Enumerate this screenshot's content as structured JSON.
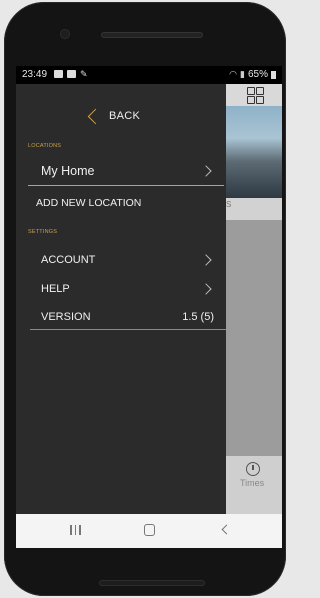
{
  "status_bar": {
    "time": "23:49",
    "battery_percent": "65%"
  },
  "drawer": {
    "back_label": "BACK",
    "locations_header": "LOCATIONS",
    "locations": [
      {
        "label": "My Home"
      }
    ],
    "add_location_label": "ADD NEW LOCATION",
    "settings_header": "SETTINGS",
    "settings_items": [
      {
        "label": "ACCOUNT"
      },
      {
        "label": "HELP"
      }
    ],
    "version_label": "VERSION",
    "version_value": "1.5 (5)"
  },
  "background_app": {
    "card_text": "S",
    "tab_label": "Times"
  },
  "icons": {
    "back": "chevron-left-icon",
    "row": "chevron-right-icon",
    "grid": "grid-icon",
    "times": "clock-icon",
    "nav": [
      "recents-icon",
      "home-icon",
      "back-icon"
    ]
  },
  "colors": {
    "accent": "#c9a24a",
    "drawer_bg": "#2b2b2b",
    "text": "#f0f0f0"
  }
}
